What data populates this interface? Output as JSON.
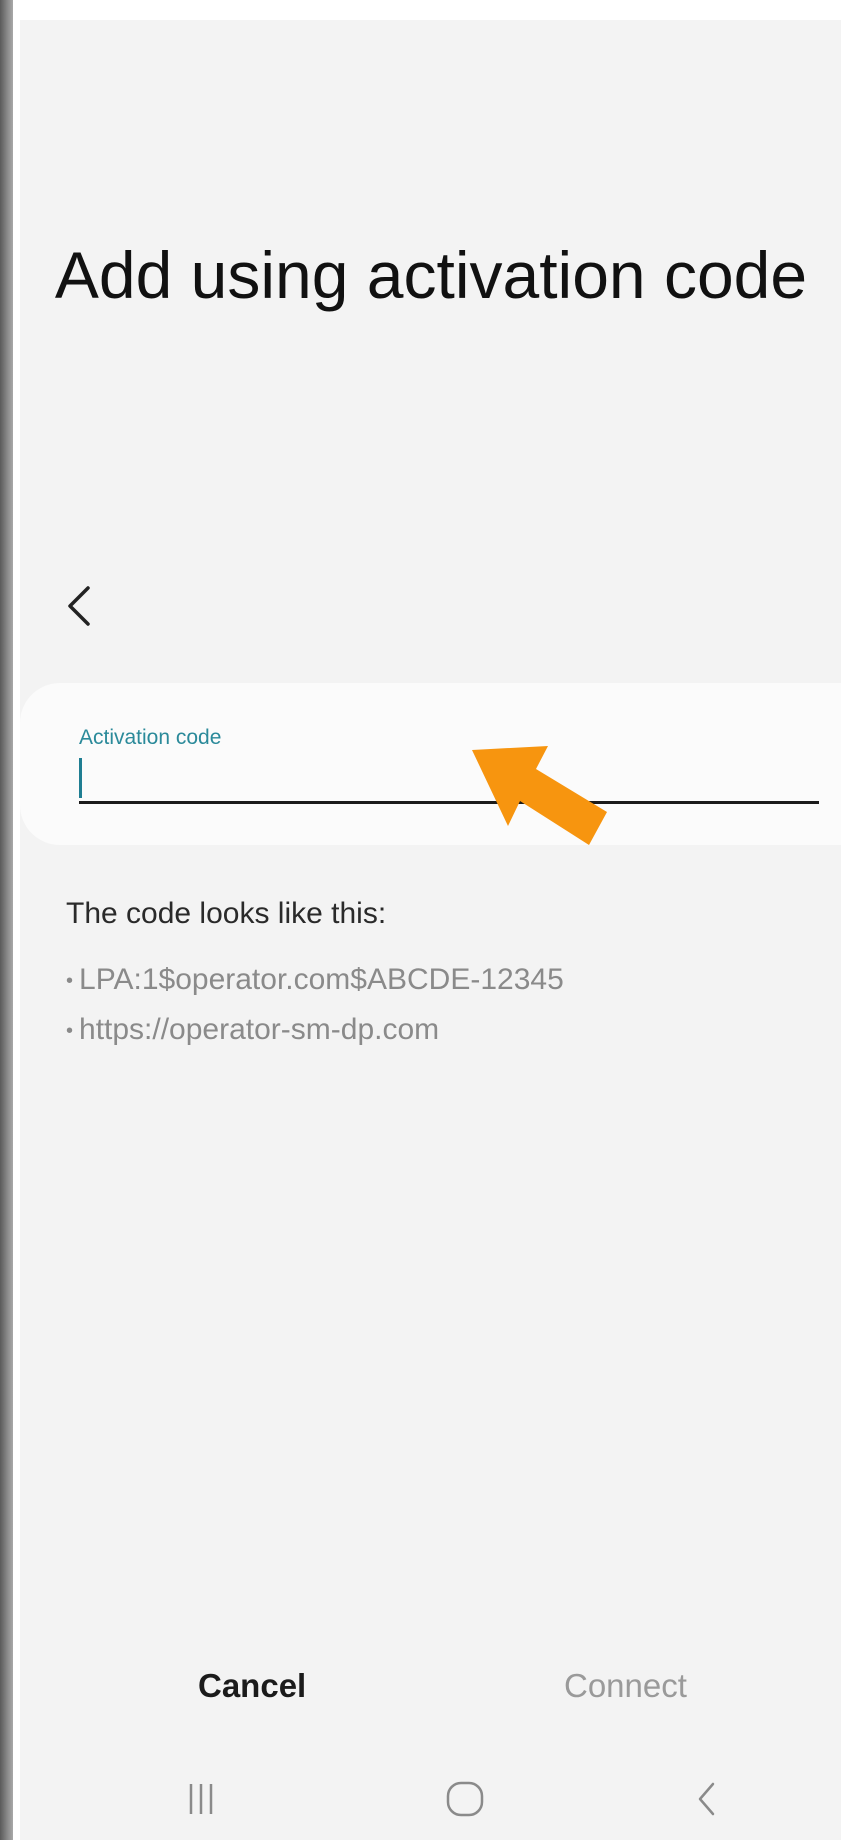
{
  "page": {
    "title": "Add using activation code"
  },
  "form": {
    "field_label": "Activation code",
    "field_value": "",
    "field_placeholder": ""
  },
  "hints": {
    "heading": "The code looks like this:",
    "bullet": "•",
    "examples": [
      "LPA:1$operator.com$ABCDE-12345",
      "https://operator-sm-dp.com"
    ]
  },
  "actions": {
    "cancel_label": "Cancel",
    "connect_label": "Connect",
    "connect_enabled": false
  },
  "icons": {
    "back": "back-chevron-icon",
    "annotation": "orange-pointer-arrow",
    "nav_recents": "recents-icon",
    "nav_home": "home-icon",
    "nav_back": "back-icon"
  },
  "colors": {
    "screen_bg": "#f3f3f3",
    "card_bg": "#fbfbfb",
    "field_label": "#2b8a9a",
    "annotation_arrow": "#f7950f",
    "disabled_text": "#9a9a9a"
  }
}
